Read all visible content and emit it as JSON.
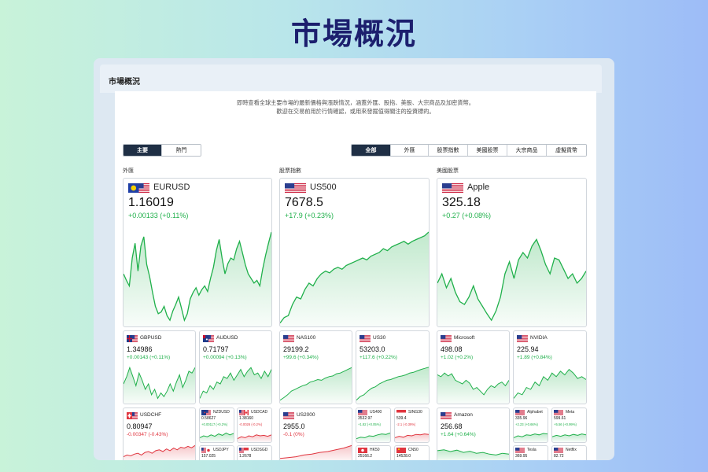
{
  "page_title": "市場概況",
  "window": {
    "title": "市場概況"
  },
  "description": [
    "即時查看全球主要市場的最新價格與漲跌情況，涵蓋外匯、股指、美股、大宗商品及加密貨幣。",
    "歡迎在交易前用於行情確認，或用來發掘值得關注的投資標的。"
  ],
  "left_tabs": [
    "主要",
    "熱門"
  ],
  "right_tabs": [
    "全部",
    "外匯",
    "股票指數",
    "美國股票",
    "大宗商品",
    "虛擬貨幣"
  ],
  "sections": {
    "forex": "外匯",
    "indices": "股票指數",
    "us_stocks": "美國股票"
  },
  "colors": {
    "up": "#20b04b",
    "down": "#e0353f",
    "active_tab": "#1f2f45"
  },
  "cards": {
    "EURUSD": {
      "symbol": "EURUSD",
      "price": "1.16019",
      "change": "+0.00133 (+0.11%)",
      "dir": "up",
      "flag": "eu-us-flag",
      "series": [
        0.55,
        0.48,
        0.42,
        0.72,
        0.88,
        0.58,
        0.85,
        0.95,
        0.65,
        0.52,
        0.35,
        0.2,
        0.12,
        0.14,
        0.2,
        0.1,
        0.05,
        0.15,
        0.22,
        0.3,
        0.18,
        0.05,
        0.12,
        0.28,
        0.35,
        0.4,
        0.32,
        0.38,
        0.42,
        0.36,
        0.5,
        0.62,
        0.8,
        0.92,
        0.72,
        0.55,
        0.66,
        0.72,
        0.7,
        0.82,
        0.9,
        0.78,
        0.65,
        0.55,
        0.5,
        0.45,
        0.48,
        0.42,
        0.6,
        0.75,
        0.88,
        1.0
      ]
    },
    "US500": {
      "symbol": "US500",
      "price": "7678.5",
      "change": "+17.9 (+0.23%)",
      "dir": "up",
      "flag": "us-flag",
      "series": [
        0.02,
        0.08,
        0.1,
        0.22,
        0.3,
        0.28,
        0.38,
        0.45,
        0.42,
        0.5,
        0.55,
        0.58,
        0.56,
        0.6,
        0.62,
        0.6,
        0.64,
        0.66,
        0.68,
        0.7,
        0.72,
        0.7,
        0.74,
        0.76,
        0.78,
        0.82,
        0.8,
        0.84,
        0.86,
        0.88,
        0.9,
        0.87,
        0.9,
        0.92,
        0.94,
        0.96,
        1.0
      ]
    },
    "Apple": {
      "symbol": "Apple",
      "price": "325.18",
      "change": "+0.27 (+0.08%)",
      "dir": "up",
      "flag": "us-flag",
      "series": [
        0.45,
        0.55,
        0.4,
        0.5,
        0.35,
        0.25,
        0.22,
        0.3,
        0.42,
        0.28,
        0.2,
        0.12,
        0.05,
        0.15,
        0.3,
        0.55,
        0.68,
        0.5,
        0.7,
        0.78,
        0.72,
        0.85,
        0.92,
        0.8,
        0.65,
        0.55,
        0.72,
        0.7,
        0.6,
        0.5,
        0.55,
        0.45,
        0.5,
        0.58
      ]
    },
    "GBPUSD": {
      "symbol": "GBPUSD",
      "price": "1.34986",
      "change": "+0.00143 (+0.11%)",
      "dir": "up",
      "flag": "gb-us-flag",
      "series": [
        0.5,
        0.7,
        0.95,
        0.7,
        0.45,
        0.8,
        0.6,
        0.35,
        0.5,
        0.2,
        0.35,
        0.1,
        0.25,
        0.15,
        0.3,
        0.5,
        0.3,
        0.55,
        0.75,
        0.4,
        0.6,
        0.85,
        0.8,
        0.95
      ]
    },
    "AUDUSD": {
      "symbol": "AUDUSD",
      "price": "0.71797",
      "change": "+0.00094 (+0.13%)",
      "dir": "up",
      "flag": "au-us-flag",
      "series": [
        0.1,
        0.3,
        0.25,
        0.45,
        0.35,
        0.55,
        0.5,
        0.7,
        0.65,
        0.8,
        0.6,
        0.75,
        0.9,
        0.7,
        0.85,
        0.95,
        0.75,
        0.8,
        0.65,
        0.85,
        0.7,
        0.9
      ]
    },
    "NAS100": {
      "symbol": "NAS100",
      "price": "29199.2",
      "change": "+99.6 (+0.34%)",
      "dir": "up",
      "flag": "us-flag",
      "series": [
        0.05,
        0.12,
        0.2,
        0.3,
        0.35,
        0.4,
        0.45,
        0.48,
        0.55,
        0.58,
        0.62,
        0.6,
        0.66,
        0.7,
        0.72,
        0.78,
        0.8,
        0.85,
        0.9,
        0.95
      ]
    },
    "US30": {
      "symbol": "US30",
      "price": "53203.0",
      "change": "+117.6 (+0.22%)",
      "dir": "up",
      "flag": "us-flag",
      "series": [
        0.05,
        0.15,
        0.2,
        0.3,
        0.38,
        0.42,
        0.5,
        0.55,
        0.6,
        0.62,
        0.66,
        0.7,
        0.72,
        0.75,
        0.8,
        0.82,
        0.86,
        0.9,
        0.93,
        0.96
      ]
    },
    "Microsoft": {
      "symbol": "Microsoft",
      "price": "498.08",
      "change": "+1.02 (+0.2%)",
      "dir": "up",
      "flag": "us-flag",
      "series": [
        0.75,
        0.7,
        0.8,
        0.72,
        0.78,
        0.6,
        0.55,
        0.5,
        0.6,
        0.52,
        0.35,
        0.4,
        0.3,
        0.2,
        0.35,
        0.45,
        0.4,
        0.5,
        0.55,
        0.45,
        0.6
      ]
    },
    "NVIDIA": {
      "symbol": "NVIDIA",
      "price": "225.94",
      "change": "+1.89 (+0.84%)",
      "dir": "up",
      "flag": "us-flag",
      "series": [
        0.1,
        0.25,
        0.2,
        0.4,
        0.35,
        0.55,
        0.45,
        0.7,
        0.6,
        0.8,
        0.7,
        0.85,
        0.75,
        0.9,
        0.8,
        0.65,
        0.7,
        0.62
      ]
    },
    "USDCHF": {
      "symbol": "USDCHF",
      "price": "0.80947",
      "change": "-0.00347 (-0.43%)",
      "dir": "down",
      "flag": "ch-us-flag",
      "series": [
        0.2,
        0.3,
        0.25,
        0.35,
        0.4,
        0.3,
        0.45,
        0.5,
        0.4,
        0.55,
        0.6,
        0.5,
        0.65,
        0.55,
        0.7,
        0.6,
        0.75,
        0.7,
        0.8,
        0.72,
        0.85
      ]
    },
    "NZDUSD": {
      "symbol": "NZDUSD",
      "price": "0.58627",
      "change": "+0.00117 (+0.2%)",
      "dir": "up",
      "flag": "nz-us-flag",
      "series": [
        0.3,
        0.5,
        0.4,
        0.6,
        0.45,
        0.7,
        0.55,
        0.8,
        0.6,
        0.75
      ]
    },
    "USDCAD": {
      "symbol": "USDCAD",
      "price": "1.38160",
      "change": "-0.0026 (-0.2%)",
      "dir": "down",
      "flag": "us-ca-flag",
      "series": [
        0.2,
        0.4,
        0.3,
        0.5,
        0.4,
        0.6,
        0.5,
        0.55,
        0.45,
        0.6
      ]
    },
    "USDJPY": {
      "symbol": "USDJPY",
      "price": "157.025",
      "change": "",
      "dir": "up",
      "flag": "us-jp-flag",
      "series": []
    },
    "USDSGD": {
      "symbol": "USDSGD",
      "price": "1.2678",
      "change": "",
      "dir": "up",
      "flag": "us-sg-flag",
      "series": []
    },
    "US2000": {
      "symbol": "US2000",
      "price": "2955.0",
      "change": "-0.1 (0%)",
      "dir": "down",
      "flag": "us-flag",
      "series": [
        0.1,
        0.15,
        0.2,
        0.3,
        0.35,
        0.45,
        0.5,
        0.6,
        0.7,
        0.85
      ]
    },
    "US400": {
      "symbol": "US400",
      "price": "3532.97",
      "change": "+1.82 (+0.05%)",
      "dir": "up",
      "flag": "us-flag",
      "series": [
        0.2,
        0.35,
        0.3,
        0.5,
        0.45,
        0.6,
        0.7,
        0.65,
        0.8
      ]
    },
    "SING30": {
      "symbol": "SING30",
      "price": "539.4",
      "change": "-2.1 (-0.39%)",
      "dir": "down",
      "flag": "sg-flag",
      "series": [
        0.3,
        0.45,
        0.35,
        0.55,
        0.5,
        0.65,
        0.6,
        0.7,
        0.65
      ]
    },
    "HK50": {
      "symbol": "HK50",
      "price": "25166.2",
      "change": "",
      "dir": "up",
      "flag": "hk-flag",
      "series": []
    },
    "CN50": {
      "symbol": "CN50",
      "price": "14528.0",
      "change": "",
      "dir": "up",
      "flag": "cn-flag",
      "series": []
    },
    "Amazon": {
      "symbol": "Amazon",
      "price": "256.68",
      "change": "+1.64 (+0.64%)",
      "dir": "up",
      "flag": "us-flag",
      "series": [
        0.55,
        0.6,
        0.5,
        0.58,
        0.45,
        0.52,
        0.4,
        0.45,
        0.35,
        0.3,
        0.4,
        0.35
      ]
    },
    "Alphabet": {
      "symbol": "Alphabet",
      "price": "335.96",
      "change": "+2.23 (+0.66%)",
      "dir": "up",
      "flag": "us-flag",
      "series": [
        0.3,
        0.5,
        0.4,
        0.6,
        0.55,
        0.7,
        0.6,
        0.75,
        0.7
      ]
    },
    "Meta": {
      "symbol": "Meta",
      "price": "599.61",
      "change": "+5.56 (+0.99%)",
      "dir": "up",
      "flag": "us-flag",
      "series": [
        0.4,
        0.55,
        0.45,
        0.6,
        0.5,
        0.65,
        0.55,
        0.7,
        0.6
      ]
    },
    "Tesla": {
      "symbol": "Tesla",
      "price": "369.95",
      "change": "",
      "dir": "up",
      "flag": "us-flag",
      "series": []
    },
    "Netflix": {
      "symbol": "Netflix",
      "price": "82.72",
      "change": "",
      "dir": "up",
      "flag": "us-flag",
      "series": []
    }
  }
}
